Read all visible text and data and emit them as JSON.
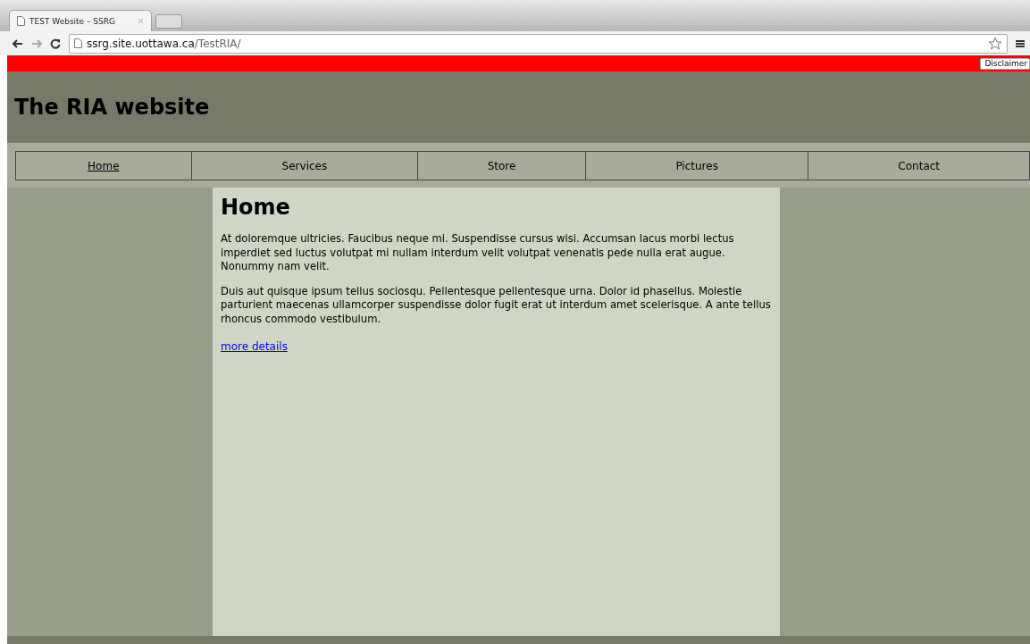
{
  "browser": {
    "tab_title": "TEST Website – SSRG",
    "url_host": "ssrg.site.uottawa.ca",
    "url_path": "/TestRIA/"
  },
  "disclaimer": "Disclaimer",
  "site_title": "The RIA website",
  "nav": [
    {
      "label": "Home",
      "selected": true
    },
    {
      "label": "Services",
      "selected": false
    },
    {
      "label": "Store",
      "selected": false
    },
    {
      "label": "Pictures",
      "selected": false
    },
    {
      "label": "Contact",
      "selected": false
    }
  ],
  "content": {
    "heading": "Home",
    "paragraphs": [
      "At doloremque ultricies. Faucibus neque mi. Suspendisse cursus wisi. Accumsan lacus morbi lectus imperdiet sed luctus volutpat mi nullam interdum velit volutpat venenatis pede nulla erat augue. Nonummy nam velit.",
      "Duis aut quisque ipsum tellus sociosqu. Pellentesque pellentesque urna. Dolor id phasellus. Molestie parturient maecenas ullamcorper suspendisse dolor fugit erat ut interdum amet scelerisque. A ante tellus rhoncus commodo vestibulum."
    ],
    "link": "more details"
  }
}
